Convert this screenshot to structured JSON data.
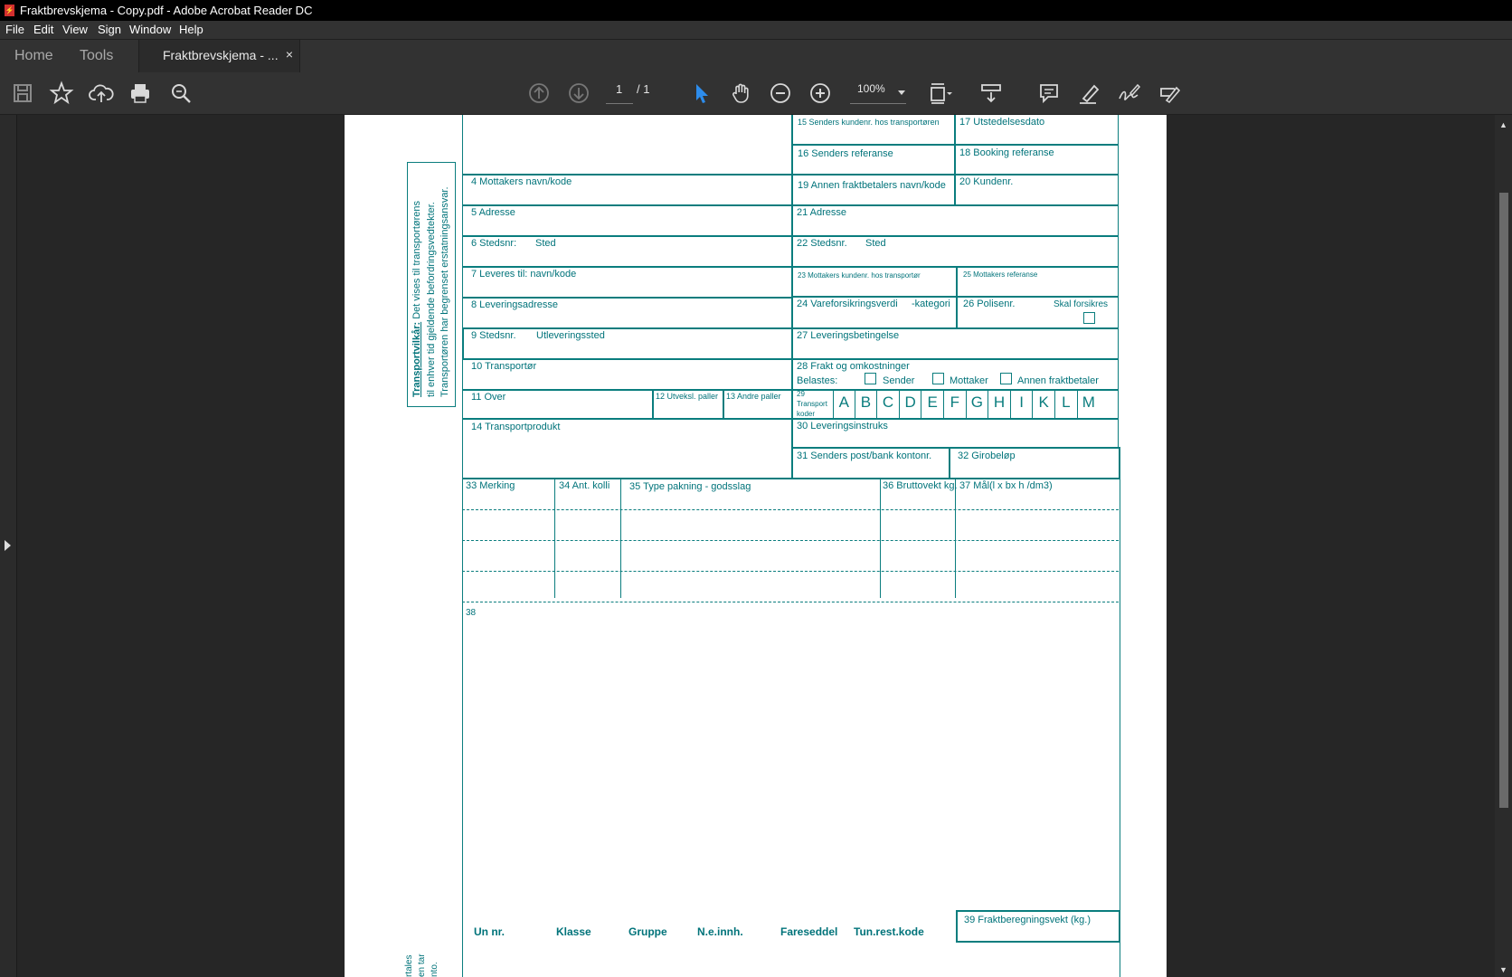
{
  "window": {
    "title": "Fraktbrevskjema - Copy.pdf - Adobe Acrobat Reader DC",
    "icon": "pdf-icon"
  },
  "menu": [
    "File",
    "Edit",
    "View",
    "Sign",
    "Window",
    "Help"
  ],
  "tabs": {
    "home": "Home",
    "tools": "Tools",
    "document": "Fraktbrevskjema - ...",
    "close": "×"
  },
  "toolbar": {
    "page_current": "1",
    "page_total": "/ 1",
    "zoom": "100%",
    "icons": [
      "save-icon",
      "bookmark-star-icon",
      "upload-cloud-icon",
      "print-icon",
      "search-zoom-icon",
      "page-up-icon",
      "page-down-icon",
      "select-cursor-icon",
      "hand-icon",
      "zoom-out-icon",
      "zoom-in-icon",
      "fit-page-icon",
      "scroll-mode-icon",
      "comment-icon",
      "highlight-pen-icon",
      "sign-icon",
      "fill-sign-icon"
    ]
  },
  "form": {
    "side_box": {
      "heading": "Transportvilkår:",
      "line1_rest": " Det vises til transportørens",
      "line2": "til enhver tid gjeldende befordringsvedtekter.",
      "line3": "Transportøren har begrenset erstatningsansvar."
    },
    "f4": "4 Mottakers navn/kode",
    "f5": "5 Adresse",
    "f6a": "6 Stedsnr:",
    "f6b": "Sted",
    "f7": "7 Leveres til: navn/kode",
    "f8": "8 Leveringsadresse",
    "f9a": "9 Stedsnr.",
    "f9b": "Utleveringssted",
    "f10": "10 Transportør",
    "f11": "11 Over",
    "f12": "12 Utveksl. paller",
    "f13": "13 Andre paller",
    "f14": "14 Transportprodukt",
    "f15": "15 Senders kundenr. hos transportøren",
    "f16": "16 Senders referanse",
    "f17": "17 Utstedelsesdato",
    "f18": "18 Booking referanse",
    "f19": "19 Annen fraktbetalers navn/kode",
    "f20": "20 Kundenr.",
    "f21": "21 Adresse",
    "f22a": "22 Stedsnr.",
    "f22b": "Sted",
    "f23": "23 Mottakers kundenr. hos transportør",
    "f24a": "24 Vareforsikringsverdi",
    "f24b": "-kategori",
    "f25": "25 Mottakers referanse",
    "f26a": "26 Polisenr.",
    "f26b": "Skal forsikres",
    "f27": "27 Leveringsbetingelse",
    "f28": "28 Frakt og omkostninger",
    "belastes": "Belastes:",
    "opt_sender": "Sender",
    "opt_mottaker": "Mottaker",
    "opt_annen": "Annen fraktbetaler",
    "f29a": "29",
    "f29b": "Transport",
    "f29c": "koder",
    "letters": [
      "A",
      "B",
      "C",
      "D",
      "E",
      "F",
      "G",
      "H",
      "I",
      "K",
      "L",
      "M"
    ],
    "f30": "30 Leveringsinstruks",
    "f31": "31 Senders post/bank kontonr.",
    "f32": "32 Girobeløp",
    "f33": "33 Merking",
    "f34": "34 Ant. kolli",
    "f35": "35 Type pakning - godsslag",
    "f36": "36 Bruttovekt kg.",
    "f37": "37 Mål(l x bx h /dm3)",
    "f38": "38",
    "f39": "39 Fraktberegningsvekt (kg.)",
    "bottom_labels": {
      "un": "Un nr.",
      "klasse": "Klasse",
      "gruppe": "Gruppe",
      "ne": "N.e.innh.",
      "fare": "Fareseddel",
      "tun": "Tun.rest.kode"
    },
    "cutoff_text": [
      "rtales",
      "en tar",
      "nto."
    ]
  }
}
